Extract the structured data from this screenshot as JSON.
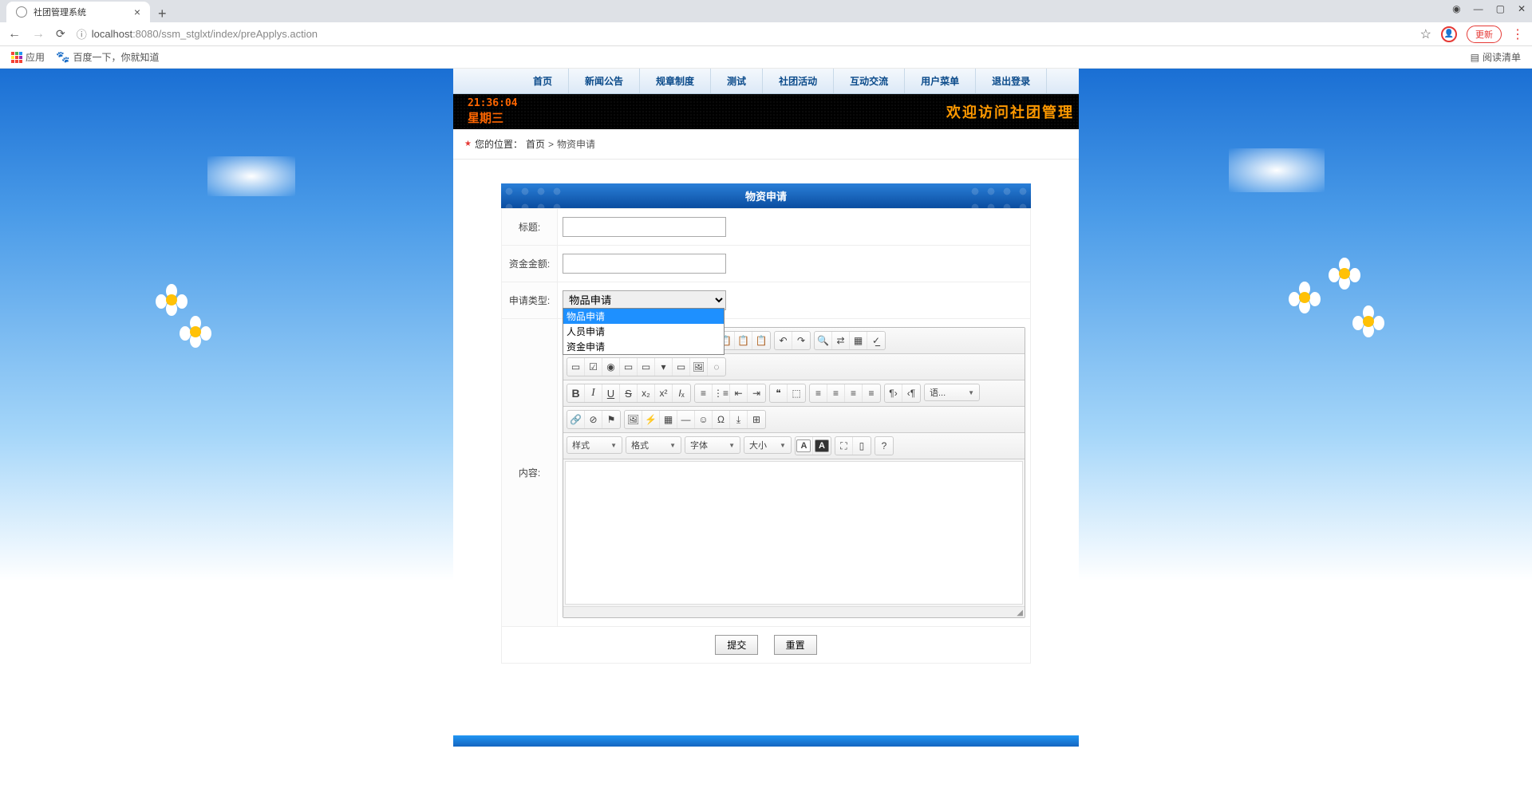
{
  "browser": {
    "tabTitle": "社团管理系统",
    "urlHost": "localhost",
    "urlPort": ":8080",
    "urlPath": "/ssm_stglxt/index/preApplys.action",
    "updateLabel": "更新",
    "appsLabel": "应用",
    "baiduLabel": "百度一下，你就知道",
    "readListLabel": "阅读清单"
  },
  "nav": {
    "items": [
      "首页",
      "新闻公告",
      "规章制度",
      "测试",
      "社团活动",
      "互动交流",
      "用户菜单",
      "退出登录"
    ]
  },
  "led": {
    "time": "21:36:04",
    "day": "星期三",
    "scrollText": "欢迎访问社团管理"
  },
  "breadcrumb": {
    "label": "您的位置：",
    "home": "首页",
    "sep": ">",
    "current": "物资申请"
  },
  "form": {
    "header": "物资申请",
    "labels": {
      "title": "标题:",
      "amount": "资金金额:",
      "type": "申请类型:",
      "content": "内容:"
    },
    "typeSelected": "物品申请",
    "typeOptions": [
      "物品申请",
      "人员申请",
      "资金申请"
    ],
    "editorCombos": {
      "style": "样式",
      "format": "格式",
      "font": "字体",
      "size": "大小",
      "lang": "语..."
    },
    "actions": {
      "submit": "提交",
      "reset": "重置"
    }
  }
}
